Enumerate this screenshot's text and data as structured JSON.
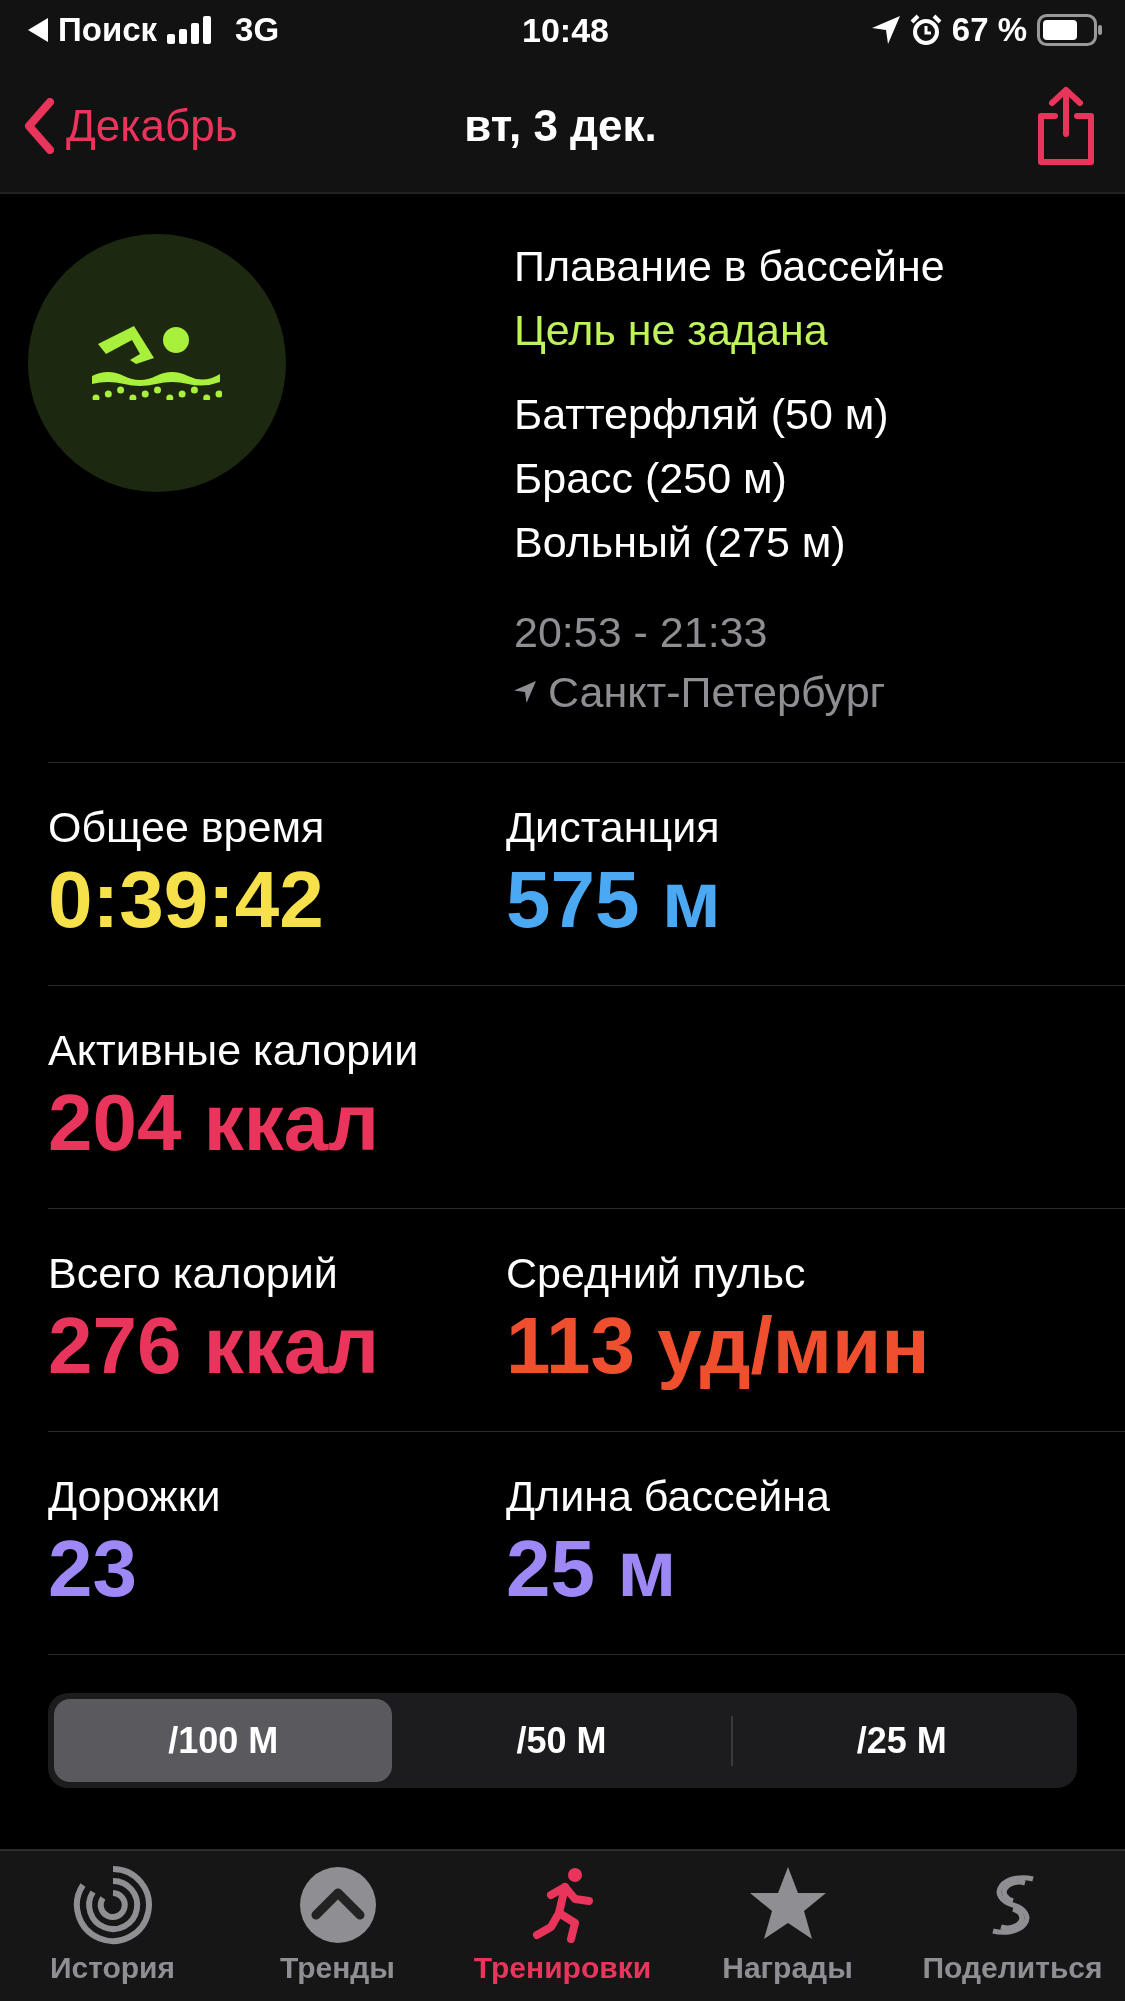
{
  "status_bar": {
    "back_app": "Поиск",
    "network": "3G",
    "time": "10:48",
    "battery": "67 %"
  },
  "nav": {
    "back": "Декабрь",
    "title": "вт, 3 дек."
  },
  "workout": {
    "name": "Плавание в бассейне",
    "goal": "Цель не задана",
    "strokes": [
      "Баттерфляй (50 м)",
      "Брасс (250 м)",
      "Вольный (275 м)"
    ],
    "time_range": "20:53 - 21:33",
    "location": "Санкт-Петербург"
  },
  "stats": [
    [
      {
        "label": "Общее время",
        "value": "0:39:42",
        "color": "#f6e14b"
      },
      {
        "label": "Дистанция",
        "value": "575 м",
        "color": "#4aa9f2"
      }
    ],
    [
      {
        "label": "Активные калории",
        "value": "204 ккал",
        "color": "#e9355b"
      }
    ],
    [
      {
        "label": "Всего калорий",
        "value": "276 ккал",
        "color": "#e9355b"
      },
      {
        "label": "Средний пульс",
        "value": "113 уд/мин",
        "color": "#f04f2f"
      }
    ],
    [
      {
        "label": "Дорожки",
        "value": "23",
        "color": "#9d88f6"
      },
      {
        "label": "Длина бассейна",
        "value": "25 м",
        "color": "#9d88f6"
      }
    ]
  ],
  "segments": [
    {
      "label": "/100 М",
      "selected": true
    },
    {
      "label": "/50 М",
      "selected": false
    },
    {
      "label": "/25 М",
      "selected": false
    }
  ],
  "tabs": [
    {
      "label": "История",
      "kind": "history",
      "selected": false
    },
    {
      "label": "Тренды",
      "kind": "trends",
      "selected": false
    },
    {
      "label": "Тренировки",
      "kind": "workouts",
      "selected": true
    },
    {
      "label": "Награды",
      "kind": "awards",
      "selected": false
    },
    {
      "label": "Поделиться",
      "kind": "share",
      "selected": false
    }
  ]
}
